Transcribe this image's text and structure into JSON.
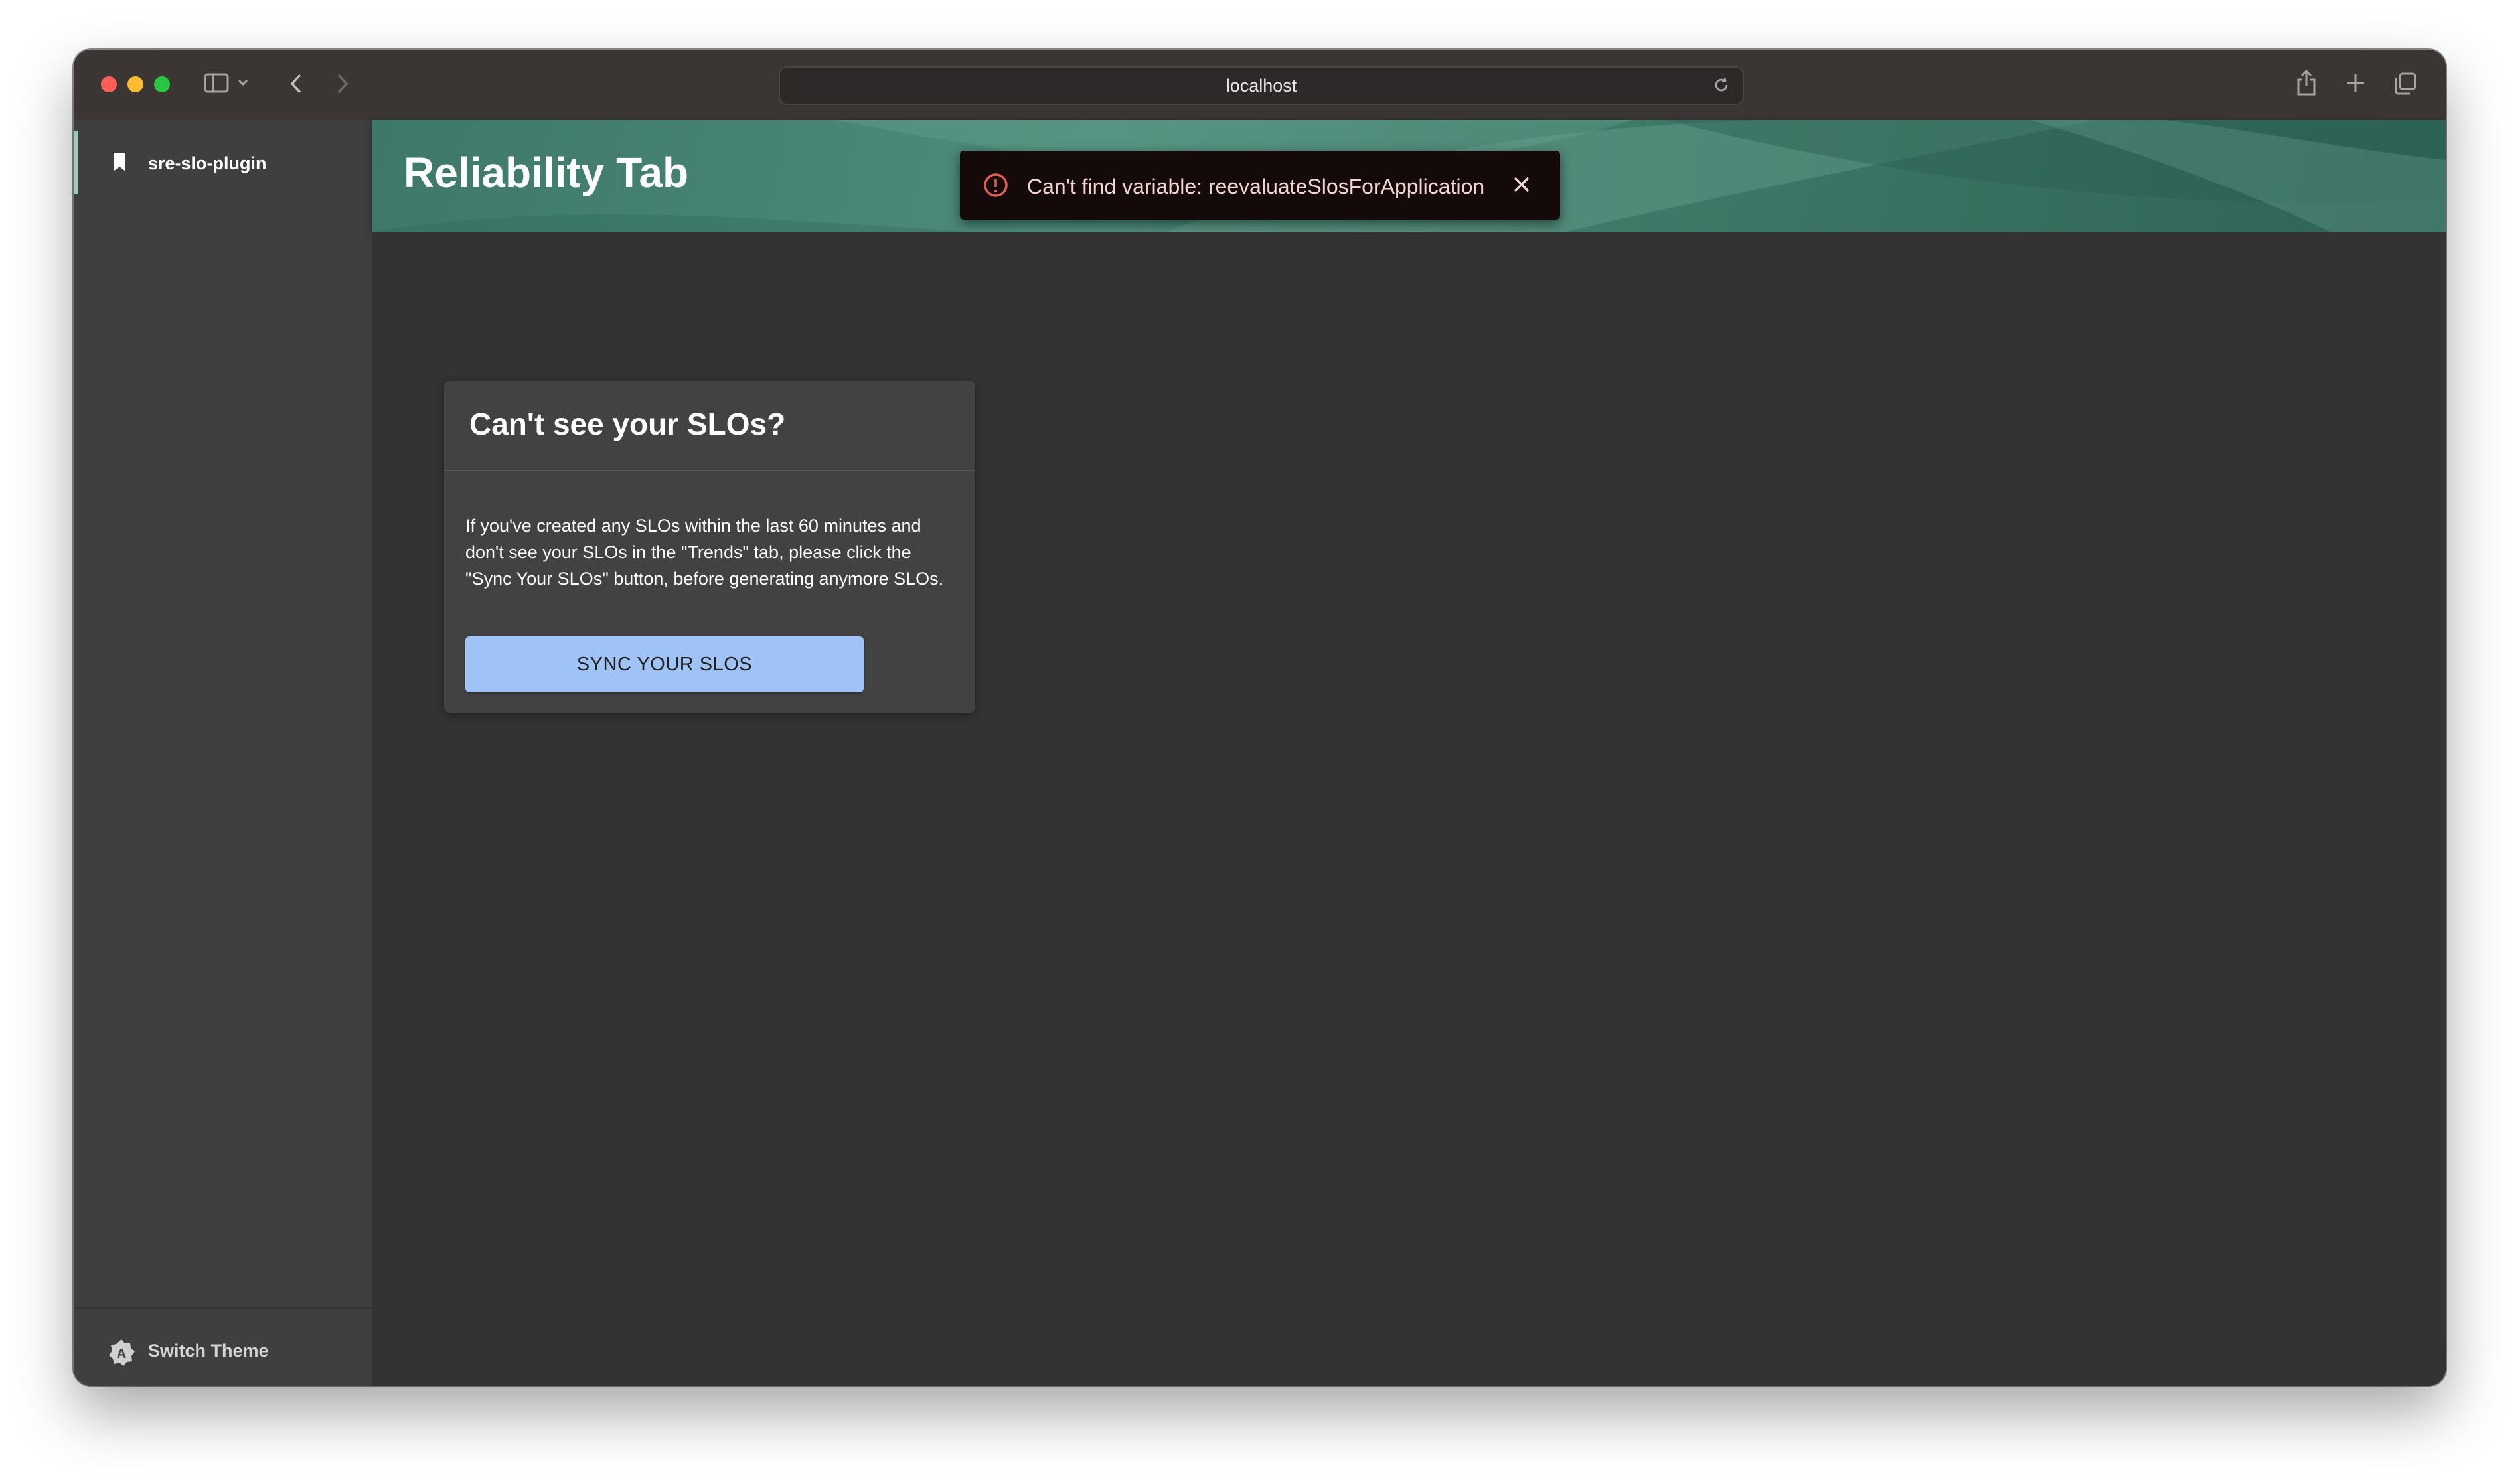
{
  "browser": {
    "url": "localhost",
    "icons": [
      "sidebar-toggle-icon",
      "chevron-down-icon",
      "back-arrow-icon",
      "forward-arrow-icon",
      "reload-icon",
      "share-icon",
      "new-tab-icon",
      "tab-overview-icon"
    ]
  },
  "sidebar": {
    "items": [
      {
        "label": "sre-slo-plugin",
        "icon": "bookmark-icon"
      }
    ],
    "footer_label": "Switch Theme",
    "footer_icon": "theme-icon"
  },
  "header": {
    "title": "Reliability Tab"
  },
  "toast": {
    "message": "Can't find variable: reevaluateSlosForApplication",
    "icon": "error-icon"
  },
  "card": {
    "title": "Can't see your SLOs?",
    "body": " If you've created any SLOs within the last 60 minutes and don't see your SLOs in the \"Trends\" tab, please click the \"Sync Your SLOs\" button, before generating anymore SLOs.",
    "button_label": "SYNC YOUR SLOS"
  },
  "colors": {
    "header_accent": "#4e8c7b",
    "button": "#9fc3f7",
    "toast_bg": "#150a0a",
    "error_icon": "#e35d52"
  }
}
